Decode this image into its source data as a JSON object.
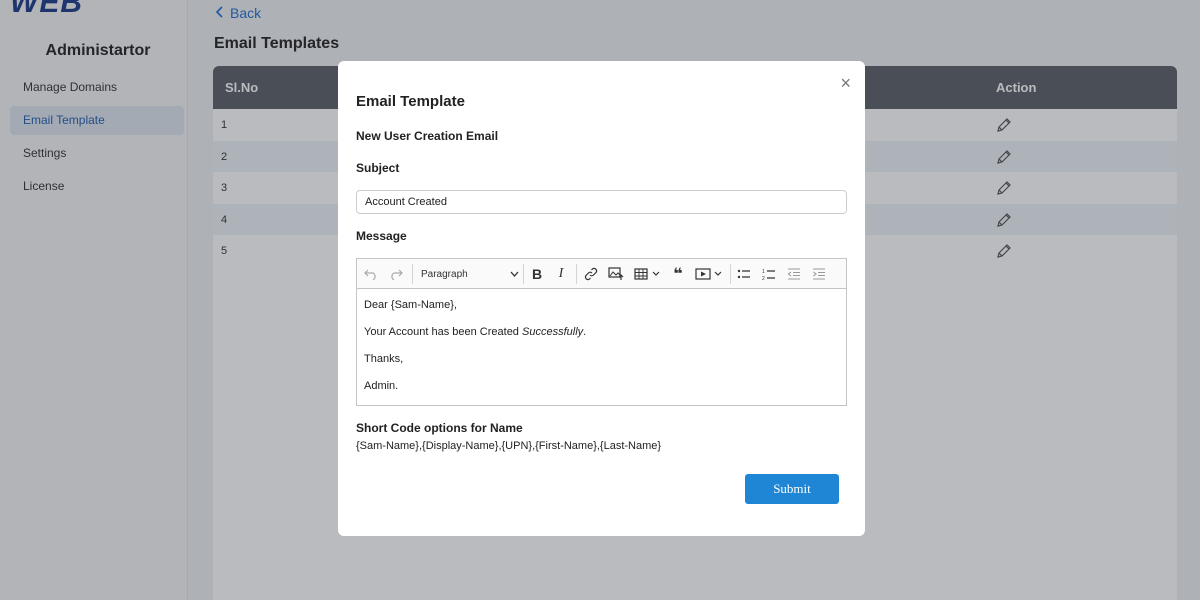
{
  "sidebar": {
    "logo_text": "WEB",
    "title": "Administartor",
    "items": [
      {
        "label": "Manage Domains"
      },
      {
        "label": "Email Template"
      },
      {
        "label": "Settings"
      },
      {
        "label": "License"
      }
    ]
  },
  "header": {
    "back_label": "Back",
    "page_title": "Email Templates"
  },
  "table": {
    "columns": [
      "Sl.No",
      "Action"
    ],
    "rows": [
      "1",
      "2",
      "3",
      "4",
      "5"
    ]
  },
  "modal": {
    "title": "Email Template",
    "template_name": "New User Creation Email",
    "subject_label": "Subject",
    "subject_value": "Account Created",
    "message_label": "Message",
    "paragraph_select": "Paragraph",
    "message_lines": {
      "line1": "Dear {Sam-Name},",
      "line2_prefix": "Your Account has been Created ",
      "line2_italic": "Successfully",
      "line2_suffix": ".",
      "line3": "Thanks,",
      "line4": "Admin."
    },
    "shortcode_label": "Short Code options for Name",
    "shortcode_text": "{Sam-Name},{Display-Name},{UPN},{First-Name},{Last-Name}",
    "submit_label": "Submit",
    "close_glyph": "×"
  },
  "colors": {
    "accent": "#1f86d6",
    "active_nav": "#1f5fb0",
    "table_header": "#5a6068"
  }
}
